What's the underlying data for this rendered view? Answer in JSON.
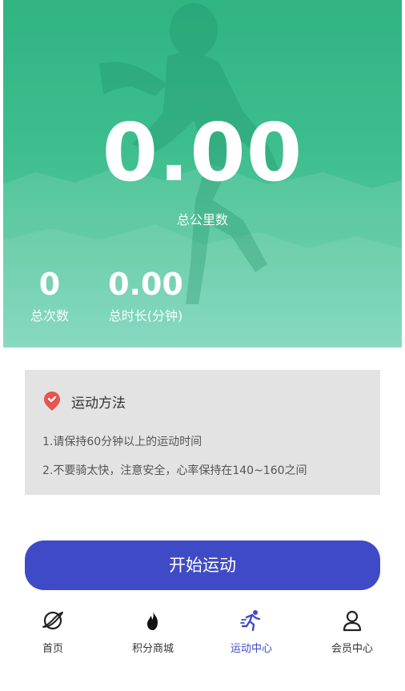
{
  "hero": {
    "distance_value": "0.00",
    "distance_label": "总公里数",
    "count_value": "0",
    "count_label": "总次数",
    "duration_value": "0.00",
    "duration_label": "总时长(分钟)"
  },
  "method": {
    "icon": "location-pin-icon",
    "title": "运动方法",
    "lines": [
      "1.请保持60分钟以上的运动时间",
      "2.不要骑太快，注意安全，心率保持在140~160之间"
    ]
  },
  "start_button": {
    "label": "开始运动"
  },
  "tabbar": {
    "items": [
      {
        "label": "首页",
        "icon": "planet-icon",
        "active": false
      },
      {
        "label": "积分商城",
        "icon": "flame-icon",
        "active": false
      },
      {
        "label": "运动中心",
        "icon": "runner-icon",
        "active": true
      },
      {
        "label": "会员中心",
        "icon": "user-icon",
        "active": false
      }
    ]
  },
  "colors": {
    "hero_green": "#3cbd8d",
    "accent_blue": "#3f4bc6",
    "card_gray": "#e3e3e3",
    "pin_red": "#e8544e"
  }
}
